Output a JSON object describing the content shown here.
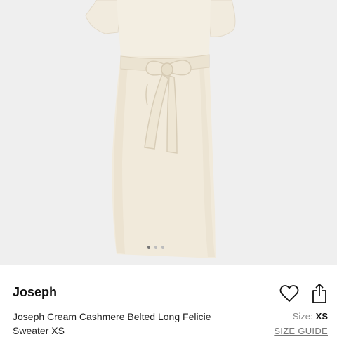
{
  "product": {
    "image": {
      "icon": "cream-belted-sweater-dress-photo",
      "background_color": "#efefef",
      "garment_color": "#f0e9da",
      "gallery_dots": 3
    },
    "brand": "Joseph",
    "title": "Joseph Cream Cashmere Belted Long Felicie Sweater XS",
    "actions": {
      "favorite_icon": "heart-icon",
      "share_icon": "share-icon"
    },
    "size_label": "Size:",
    "size_value": "XS",
    "size_guide_label": "SIZE GUIDE"
  }
}
